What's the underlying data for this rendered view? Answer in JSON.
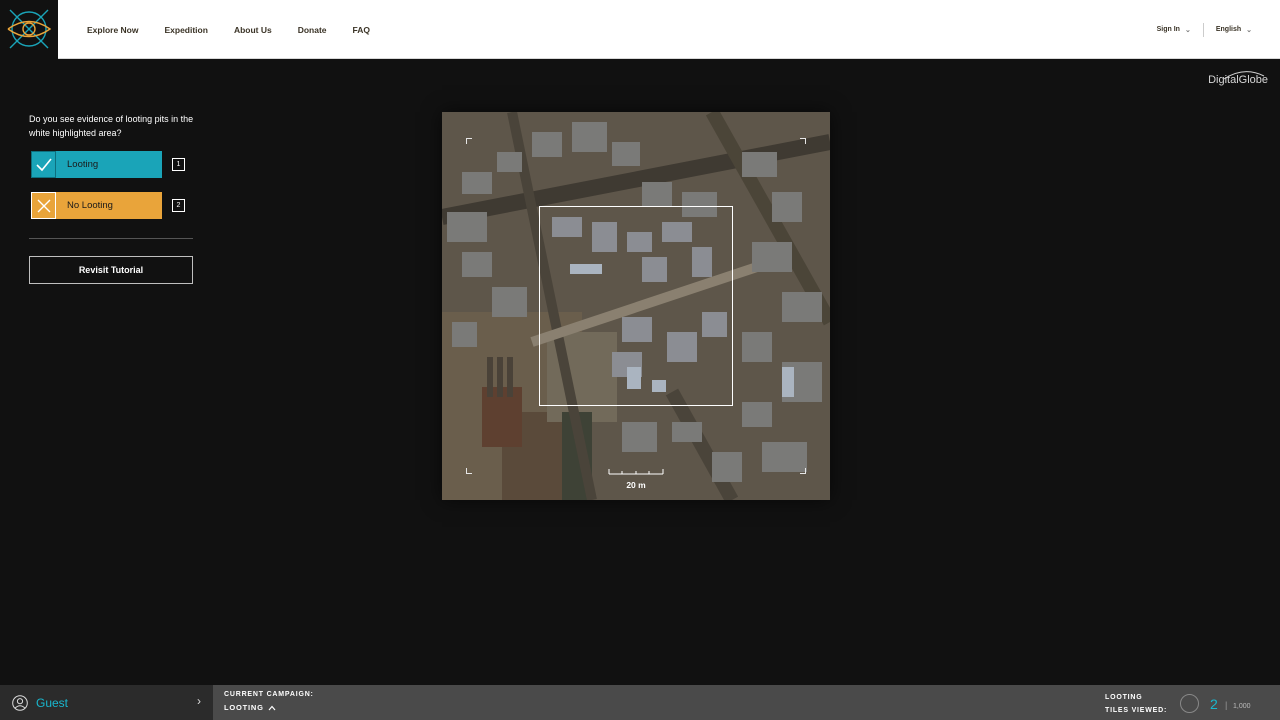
{
  "nav": {
    "links": [
      "Explore Now",
      "Expedition",
      "About Us",
      "Donate",
      "FAQ"
    ],
    "sign_in": "Sign In",
    "language": "English"
  },
  "credit": "DigitalGlobe",
  "panel": {
    "question": "Do you see evidence of looting pits in the white highlighted area?",
    "yes_label": "Looting",
    "yes_key": "1",
    "no_label": "No Looting",
    "no_key": "2",
    "revisit_label": "Revisit Tutorial"
  },
  "map": {
    "scale_label": "20 m"
  },
  "footer": {
    "user_name": "Guest",
    "campaign_caption": "CURRENT CAMPAIGN:",
    "campaign_name": "LOOTING",
    "tiles_caption_line1": "LOOTING",
    "tiles_caption_line2": "TILES VIEWED:",
    "tiles_viewed": "2",
    "tiles_total": "1,000"
  },
  "colors": {
    "looting": "#1aa4b8",
    "no_looting": "#e9a43a",
    "accent_text": "#19b8cf"
  },
  "icons": [
    "logo-icon",
    "chevron-down-icon",
    "check-icon",
    "x-icon",
    "user-icon",
    "chevron-right-icon",
    "chevron-up-icon",
    "progress-ring-icon"
  ]
}
